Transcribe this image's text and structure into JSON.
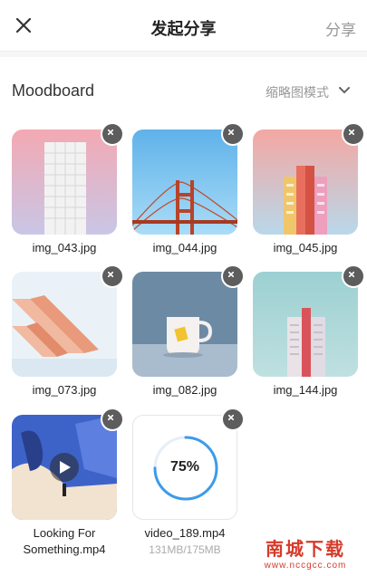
{
  "header": {
    "close_icon": "close-icon",
    "title": "发起分享",
    "share_label": "分享"
  },
  "section": {
    "label": "Moodboard",
    "view_mode": "缩略图模式",
    "chevron_icon": "chevron-down-icon"
  },
  "items": [
    {
      "caption": "img_043.jpg",
      "kind": "image"
    },
    {
      "caption": "img_044.jpg",
      "kind": "image"
    },
    {
      "caption": "img_045.jpg",
      "kind": "image"
    },
    {
      "caption": "img_073.jpg",
      "kind": "image"
    },
    {
      "caption": "img_082.jpg",
      "kind": "image"
    },
    {
      "caption": "img_144.jpg",
      "kind": "image"
    },
    {
      "caption": "Looking For Something.mp4",
      "kind": "video"
    },
    {
      "caption": "video_189.mp4",
      "kind": "uploading",
      "progress_label": "75%",
      "progress": 0.75,
      "size_label": "131MB/175MB"
    }
  ],
  "watermark": {
    "title": "南城下载",
    "url": "www.nccgcc.com"
  }
}
